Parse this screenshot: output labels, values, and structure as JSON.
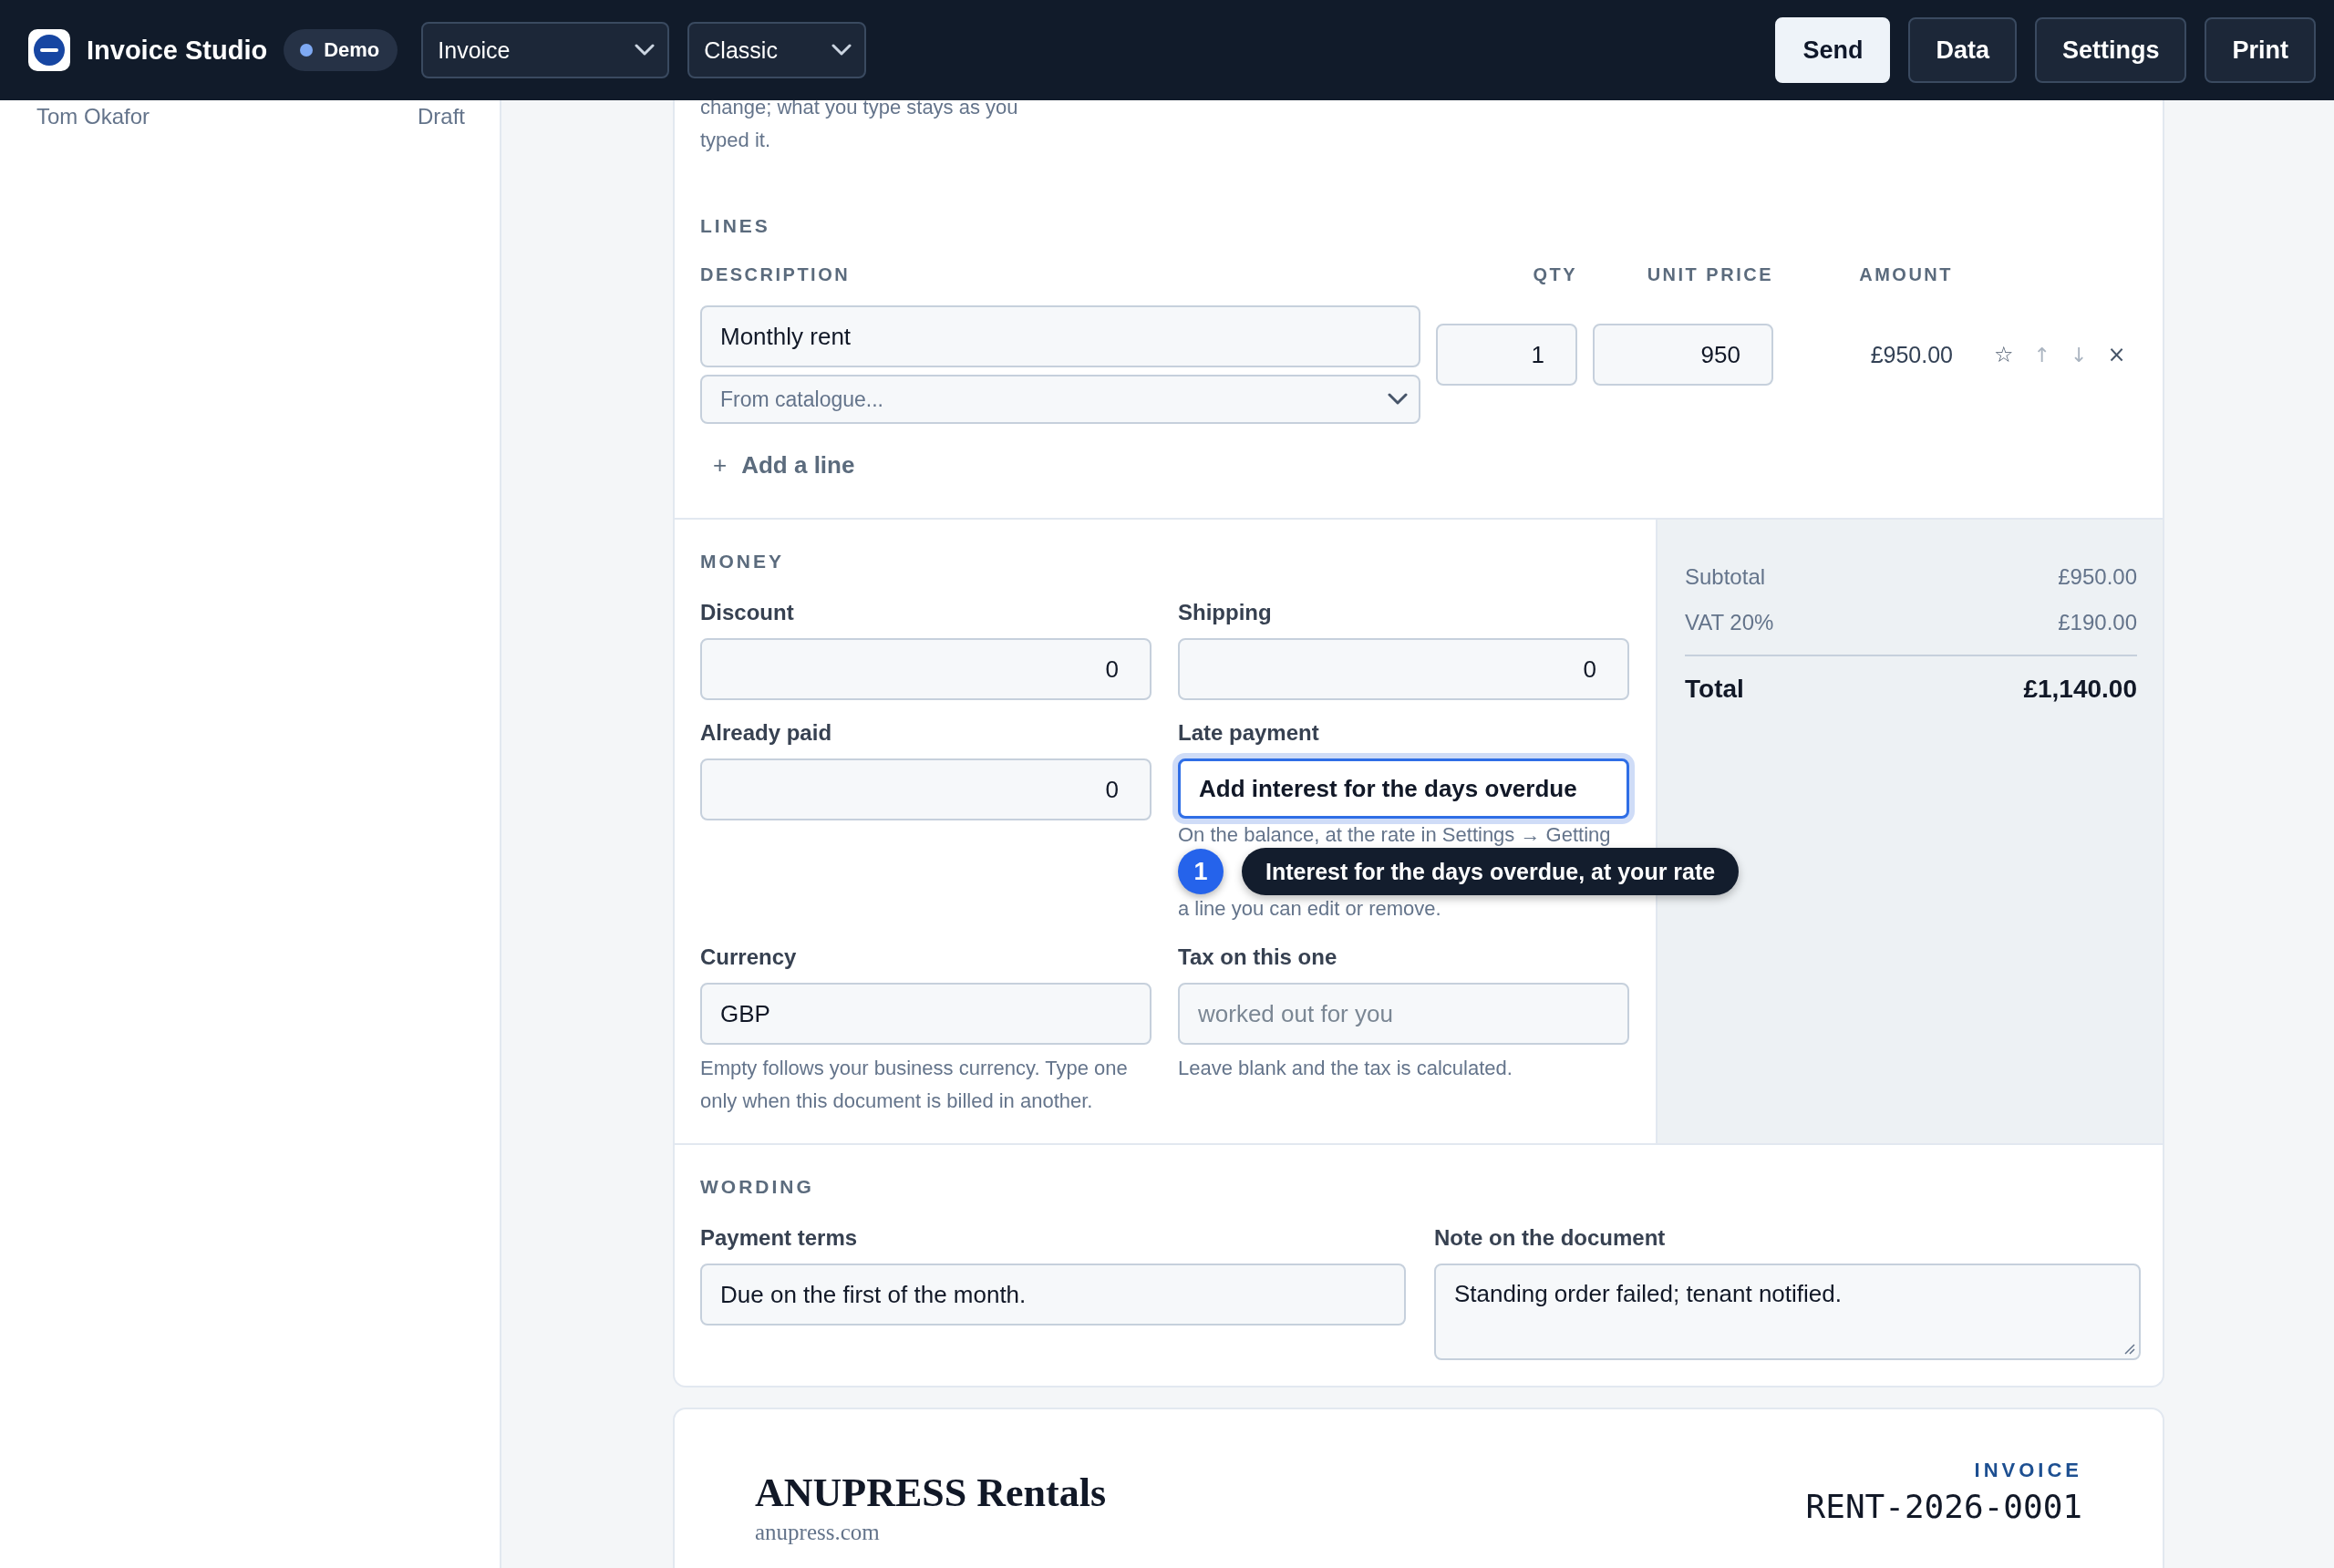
{
  "header": {
    "app_name": "Invoice Studio",
    "badge": "Demo",
    "selects": [
      {
        "kind": "doc-type",
        "value": "Invoice"
      },
      {
        "kind": "template",
        "value": "Classic"
      }
    ],
    "buttons": [
      {
        "label": "Send",
        "primary": true
      },
      {
        "label": "Data",
        "primary": false
      },
      {
        "label": "Settings",
        "primary": false
      },
      {
        "label": "Print",
        "primary": false
      }
    ]
  },
  "sidebar": {
    "items": [
      {
        "name": "Tom Okafor",
        "status": "Draft"
      }
    ]
  },
  "intro_hint": "change; what you type stays as you typed it.",
  "lines": {
    "title": "LINES",
    "columns": [
      "DESCRIPTION",
      "QTY",
      "UNIT PRICE",
      "AMOUNT"
    ],
    "rows": [
      {
        "description": "Monthly rent",
        "catalogue_placeholder": "From catalogue...",
        "qty": "1",
        "unit_price": "950",
        "amount": "£950.00",
        "actions": [
          {
            "kind": "star",
            "icon": "☆",
            "disabled": false
          },
          {
            "kind": "up",
            "icon": "↑",
            "disabled": true
          },
          {
            "kind": "down",
            "icon": "↓",
            "disabled": true
          },
          {
            "kind": "remove",
            "icon": "×",
            "disabled": false
          }
        ]
      }
    ],
    "add_icon": "+",
    "add_label": "Add a line"
  },
  "money": {
    "title": "MONEY",
    "fields": [
      {
        "label": "Discount",
        "kind": "number",
        "value": "0"
      },
      {
        "label": "Shipping",
        "kind": "number",
        "value": "0"
      },
      {
        "label": "Already paid",
        "kind": "number",
        "value": "0"
      },
      {
        "label": "Late payment",
        "kind": "choice",
        "value": "Add interest for the days overdue",
        "focused": true,
        "hint_lines": [
          "On the balance, at the rate in Settings → Getting",
          "a line you can edit or remove."
        ],
        "tooltip": {
          "step": "1",
          "text": "Interest for the days overdue, at your rate"
        }
      },
      {
        "label": "Currency",
        "kind": "text",
        "value": "GBP",
        "hint": "Empty follows your business currency. Type one only when this document is billed in another."
      },
      {
        "label": "Tax on this one",
        "kind": "text",
        "placeholder": "worked out for you",
        "hint": "Leave blank and the tax is calculated."
      }
    ]
  },
  "totals": {
    "rows": [
      {
        "label": "Subtotal",
        "value": "£950.00"
      },
      {
        "label": "VAT 20%",
        "value": "£190.00"
      }
    ],
    "total": {
      "label": "Total",
      "value": "£1,140.00"
    }
  },
  "wording": {
    "title": "WORDING",
    "fields": [
      {
        "label": "Payment terms",
        "kind": "line",
        "value": "Due on the first of the month."
      },
      {
        "label": "Note on the document",
        "kind": "area",
        "value": "Standing order failed; tenant notified."
      }
    ]
  },
  "document": {
    "business": "ANUPRESS Rentals",
    "website": "anupress.com",
    "type": "INVOICE",
    "number": "RENT-2026-0001"
  }
}
